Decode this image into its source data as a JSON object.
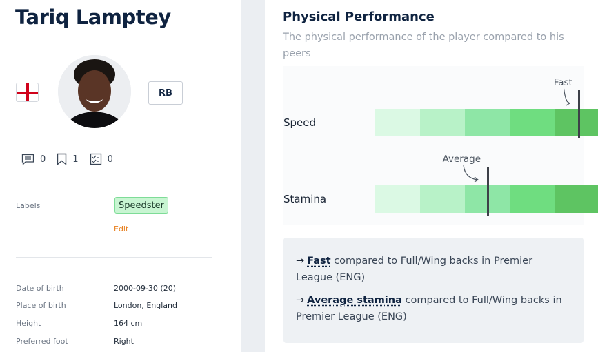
{
  "player": {
    "name": "Tariq Lamptey",
    "position": "RB"
  },
  "stats": {
    "comments": "0",
    "bookmarks": "1",
    "reports": "0"
  },
  "labels": {
    "title": "Labels",
    "tag": "Speedster",
    "edit": "Edit"
  },
  "info": [
    {
      "label": "Date of birth",
      "value": "2000-09-30 (20)"
    },
    {
      "label": "Place of birth",
      "value": "London, England"
    },
    {
      "label": "Height",
      "value": "164 cm"
    },
    {
      "label": "Preferred foot",
      "value": "Right"
    }
  ],
  "performance": {
    "title": "Physical Performance",
    "subtitle": "The physical performance of the player compared to his peers",
    "scale_colors": [
      "#dbf9e4",
      "#b8f2c8",
      "#8ee6a6",
      "#6fdd80",
      "#5ec462"
    ],
    "marker_color": "#3d4048",
    "metrics": [
      {
        "name": "Speed",
        "annotation": "Fast",
        "level": 0.905
      },
      {
        "name": "Stamina",
        "annotation": "Average",
        "level": 0.5
      }
    ]
  },
  "summary": {
    "arrow": "→",
    "lines": [
      {
        "bold": "Fast",
        "text": " compared to Full/Wing backs in Premier League (ENG)"
      },
      {
        "bold": "Average stamina",
        "text": " compared to Full/Wing backs in Premier League (ENG)"
      }
    ]
  }
}
